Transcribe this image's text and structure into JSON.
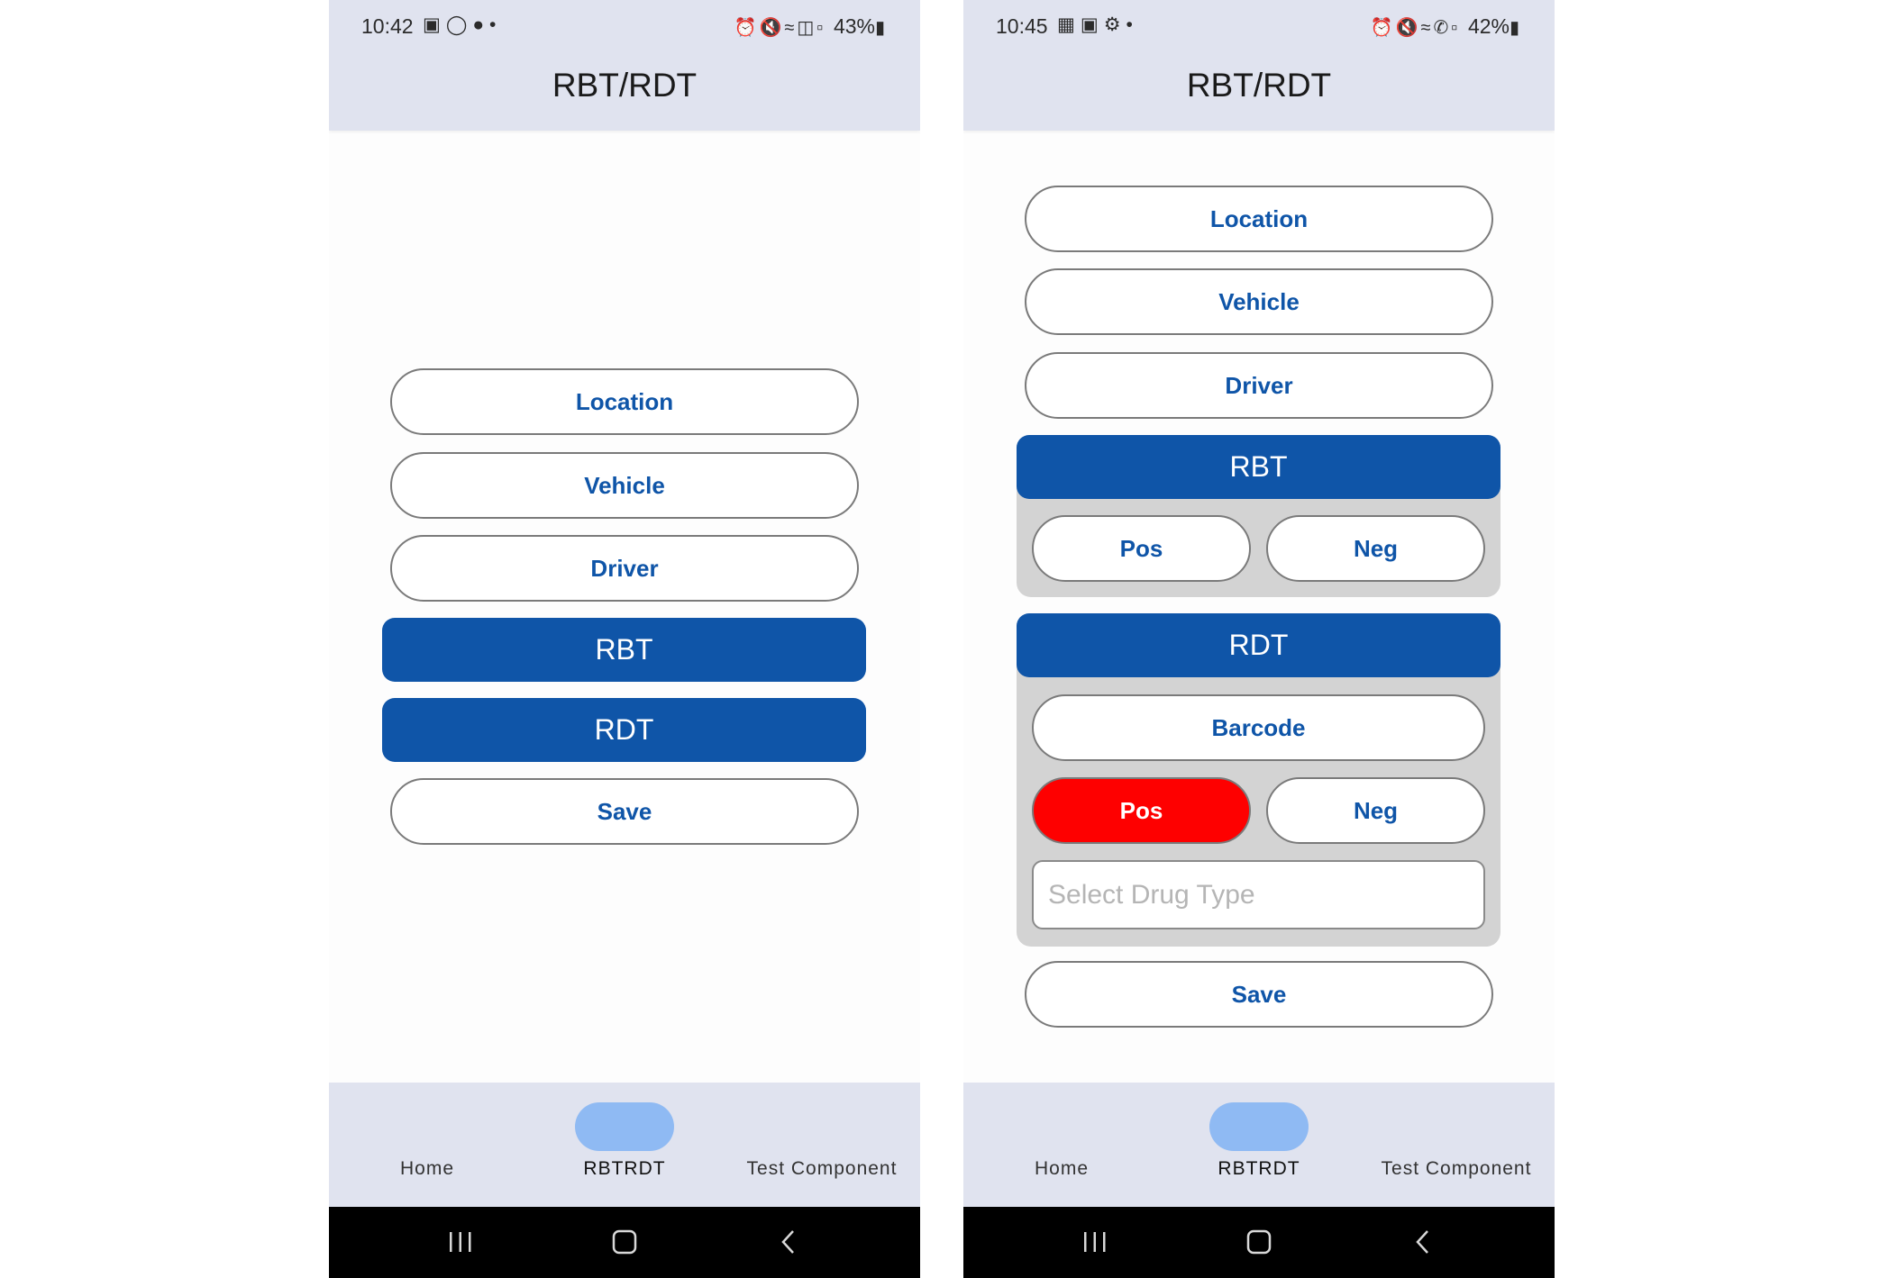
{
  "screens": [
    {
      "status": {
        "time": "10:42",
        "battery": "43%",
        "left_icons": [
          "image-icon",
          "instagram-icon",
          "bulb-icon",
          "dot-icon"
        ],
        "right_icons": [
          "alarm-icon",
          "mute-icon",
          "wifi-icon",
          "volte-icon",
          "signal-icon"
        ]
      },
      "title": "RBT/RDT",
      "buttons": {
        "location": "Location",
        "vehicle": "Vehicle",
        "driver": "Driver",
        "rbt": "RBT",
        "rdt": "RDT",
        "save": "Save"
      },
      "nav": {
        "home": "Home",
        "rbtrdt": "RBTRDT",
        "test": "Test Component"
      }
    },
    {
      "status": {
        "time": "10:45",
        "battery": "42%",
        "left_icons": [
          "outlook-icon",
          "image-icon",
          "gear-icon",
          "dot-icon"
        ],
        "right_icons": [
          "alarm-icon",
          "mute-icon",
          "wifi-icon",
          "wifi-call-icon",
          "signal-icon"
        ]
      },
      "title": "RBT/RDT",
      "buttons": {
        "location": "Location",
        "vehicle": "Vehicle",
        "driver": "Driver",
        "save": "Save"
      },
      "rbt_panel": {
        "header": "RBT",
        "pos": "Pos",
        "neg": "Neg"
      },
      "rdt_panel": {
        "header": "RDT",
        "barcode": "Barcode",
        "pos": "Pos",
        "neg": "Neg",
        "drug_placeholder": "Select Drug Type",
        "selected_result": "Pos"
      },
      "nav": {
        "home": "Home",
        "rbtrdt": "RBTRDT",
        "test": "Test Component"
      }
    }
  ],
  "colors": {
    "primary": "#0f55a8",
    "bar_bg": "#e0e3ef",
    "panel_bg": "#d3d3d3",
    "danger": "#fe0000",
    "nav_indicator": "#8fbaf3"
  }
}
